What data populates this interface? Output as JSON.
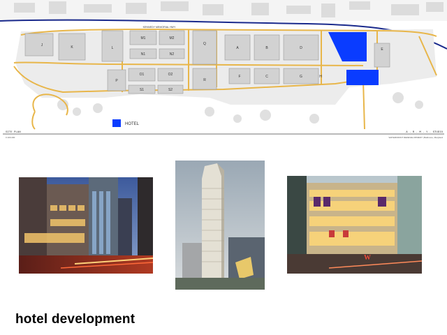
{
  "site_plan": {
    "blocks": [
      "J",
      "K",
      "L",
      "M1",
      "M2",
      "N1",
      "N2",
      "O1",
      "O2",
      "S1",
      "S2",
      "P",
      "Q",
      "R",
      "A",
      "B",
      "C",
      "D",
      "E",
      "F",
      "G",
      "H"
    ],
    "road_label": "KENNEDY MEMORIAL HWY",
    "legend_label": "HOTEL",
    "left_caption": "SITE PLAN",
    "left_subcaption": "0 100 200",
    "right_caption": "A . R . M . Y . STUDIO",
    "right_subcaption": "WATERFRONT REDEVELOPMENT | Baltimore, Maryland",
    "colors": {
      "hotel": "#0a3cff",
      "road": "#e8b64a",
      "water_line": "#1a2a8c",
      "building": "#d2d2d2"
    }
  },
  "photos": [
    {
      "name": "hotel-photo-street-night"
    },
    {
      "name": "hotel-photo-tower"
    },
    {
      "name": "hotel-photo-w-hotel"
    }
  ],
  "caption": "hotel development"
}
